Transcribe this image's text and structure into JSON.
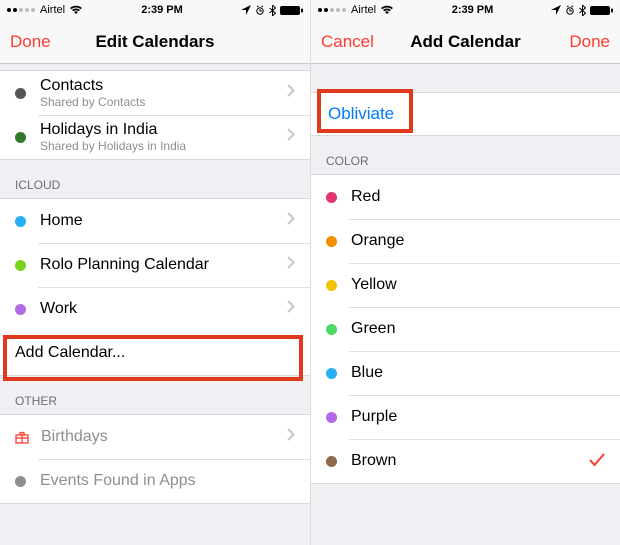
{
  "status": {
    "carrier": "Airtel",
    "time": "2:39 PM"
  },
  "left": {
    "nav": {
      "left": "Done",
      "title": "Edit Calendars"
    },
    "top_group": [
      {
        "name": "Contacts",
        "sub": "Shared by Contacts",
        "dot": "#555"
      },
      {
        "name": "Holidays in India",
        "sub": "Shared by Holidays in India",
        "dot": "#2d7a2d"
      }
    ],
    "icloud_header": "ICLOUD",
    "icloud_group": [
      {
        "name": "Home",
        "dot": "#2aaef5"
      },
      {
        "name": "Rolo Planning Calendar",
        "dot": "#7ed321"
      },
      {
        "name": "Work",
        "dot": "#b36ae2"
      }
    ],
    "add_calendar": "Add Calendar...",
    "other_header": "OTHER",
    "other_group": {
      "birthdays": "Birthdays",
      "events": "Events Found in Apps"
    }
  },
  "right": {
    "nav": {
      "left": "Cancel",
      "title": "Add Calendar",
      "right": "Done"
    },
    "input_value": "Obliviate",
    "color_header": "COLOR",
    "colors": [
      {
        "name": "Red",
        "dot": "#e2376d",
        "selected": false
      },
      {
        "name": "Orange",
        "dot": "#f58f00",
        "selected": false
      },
      {
        "name": "Yellow",
        "dot": "#f2c200",
        "selected": false
      },
      {
        "name": "Green",
        "dot": "#4cd964",
        "selected": false
      },
      {
        "name": "Blue",
        "dot": "#2aaef5",
        "selected": false
      },
      {
        "name": "Purple",
        "dot": "#b36ae2",
        "selected": false
      },
      {
        "name": "Brown",
        "dot": "#8e6a4a",
        "selected": true
      }
    ]
  }
}
